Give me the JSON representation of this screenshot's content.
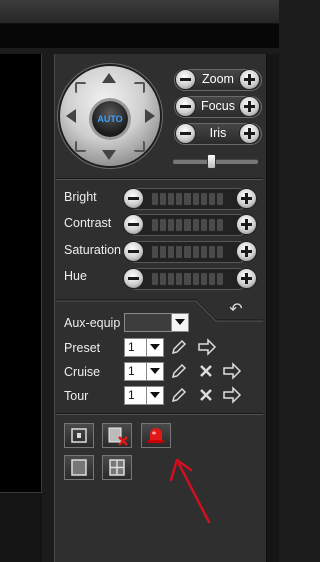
{
  "ptz": {
    "auto_label": "AUTO",
    "zoom_label": "Zoom",
    "focus_label": "Focus",
    "iris_label": "Iris",
    "speed_level": 0.45
  },
  "image_adjust": {
    "bright_label": "Bright",
    "contrast_label": "Contrast",
    "saturation_label": "Saturation",
    "hue_label": "Hue"
  },
  "aux": {
    "aux_label": "Aux-equip",
    "aux_value": ""
  },
  "preset": {
    "label": "Preset",
    "value": "1"
  },
  "cruise": {
    "label": "Cruise",
    "value": "1"
  },
  "tour": {
    "label": "Tour",
    "value": "1"
  },
  "colors": {
    "alarm_red": "#e01818",
    "annotation_red": "#d10f1f",
    "auto_text": "#3aa0ff"
  },
  "icons": [
    "pencil-icon",
    "delete-x-icon",
    "arrow-right-icon",
    "undo-icon",
    "snapshot-icon",
    "close-video-icon",
    "alarm-icon",
    "single-view-icon",
    "quad-view-icon"
  ]
}
